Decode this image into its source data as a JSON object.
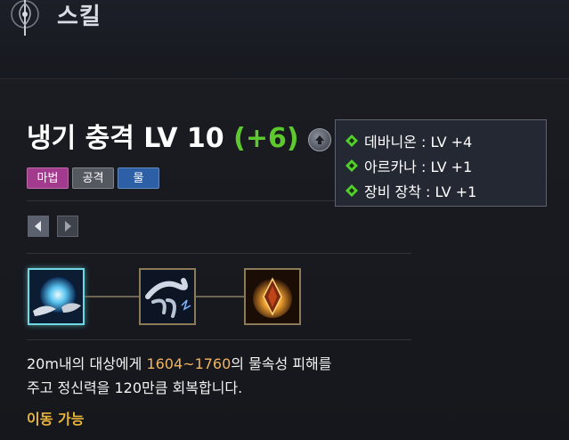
{
  "header": {
    "title": "스킬",
    "emblem_icon": "emblem-icon"
  },
  "skill": {
    "name_level": "냉기 충격 LV 10",
    "bonus": "(+6)",
    "level_up_icon": "arrow-up-icon",
    "tags": [
      {
        "label": "마법",
        "color": "#a23a8d"
      },
      {
        "label": "공격",
        "color": "#54585f"
      },
      {
        "label": "물",
        "color": "#2c5fa5"
      }
    ],
    "nav": {
      "prev_icon": "chevron-left-icon",
      "next_icon": "chevron-right-icon"
    },
    "tree": [
      {
        "icon": "water-orb-icon",
        "selected": true
      },
      {
        "icon": "water-dragon-icon",
        "selected": false
      },
      {
        "icon": "fire-crest-icon",
        "selected": false
      }
    ],
    "description": {
      "line1_pre": "20m내의 대상에게 ",
      "damage": "1604~1760",
      "line1_post": "의 물속성 피해를",
      "line2": "주고 정신력을 120만큼 회복합니다."
    },
    "movable": "이동 가능"
  },
  "tooltip": {
    "rows": [
      {
        "text": "데바니온 : LV +4",
        "icon": "green-diamond-icon"
      },
      {
        "text": "아르카나 : LV +1",
        "icon": "green-diamond-icon"
      },
      {
        "text": "장비 장착 : LV +1",
        "icon": "green-diamond-icon"
      }
    ]
  },
  "colors": {
    "accent_green": "#5ec92f",
    "damage_orange": "#f0b463",
    "movable_yellow": "#e8b43b",
    "selected_cyan": "#6fd9e3"
  }
}
